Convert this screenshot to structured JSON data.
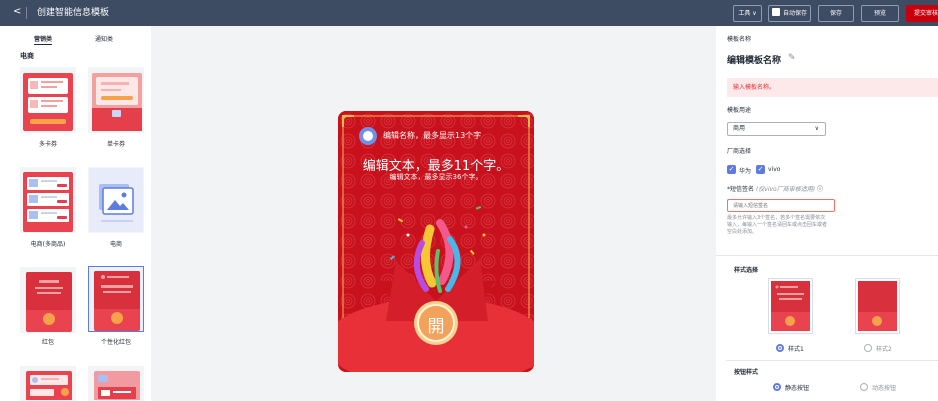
{
  "header": {
    "back": "<",
    "title": "创建智能信息模板",
    "tools": "工具 ∨",
    "autosave": "自动保存",
    "save": "保存",
    "preview": "预览",
    "submit": "提交审核"
  },
  "tabs": [
    "营销类",
    "通知类"
  ],
  "category": "电商",
  "templates": [
    "多卡券",
    "单卡券",
    "电商(多商品)",
    "电商",
    "红包",
    "个性化红包"
  ],
  "preview": {
    "title_line": "编辑名称，最多显示13个字",
    "main_text": "编辑文本，最多11个字。",
    "sub_text": "编辑文本，最多显示36个字。",
    "open_char": "開"
  },
  "form": {
    "name_label": "模板名称",
    "name_value": "编辑模板名称",
    "name_error": "输入模板名称。",
    "usage_label": "模板用途",
    "usage_value": "商用",
    "vendor_label": "厂商选择",
    "vendors": [
      "华为",
      "vivo"
    ],
    "sign_label": "*短信签名",
    "sign_note": "(仅vivo厂商审核适用)",
    "sign_placeholder": "请输入短信签名",
    "sign_help": "最多允许输入3个签名，若多个签名需要依次输入，每输入一个签名请回车或点击回车或者空白处添加。",
    "style_title": "样式选择",
    "styles": [
      "样式1",
      "样式2"
    ],
    "button_title": "按钮样式",
    "button_styles": [
      "静态按钮",
      "动态按钮"
    ]
  },
  "colors": {
    "accent": "#5e7ce0",
    "brand_red": "#c7000b",
    "header_bg": "#3d4b63"
  }
}
